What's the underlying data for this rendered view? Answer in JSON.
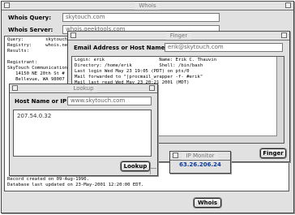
{
  "whois": {
    "title": "Whois",
    "query_label": "Whois Query:",
    "query_value": "skytouch.com",
    "server_label": "Whois Server:",
    "server_value": "whois.geektools.com",
    "output_lines": [
      "Query:        skytouch.com",
      "Registry:     whois.netw",
      "Results:",
      "",
      "Registrant:",
      "SkyTouch Communication",
      "   14150 NE 20th St #",
      "   Bellevue, WA 98007"
    ],
    "footer_lines": [
      "Record created on 09-Aug-1996.",
      "Database last updated on 23-May-2001 12:20:00 EDT."
    ],
    "button": "Whois"
  },
  "finger": {
    "title": "Finger",
    "email_label": "Email Address or Host Name:",
    "email_value": "erik@skytouch.com",
    "output_lines": [
      "Login: erik                    Name: Erik C. Thauvin",
      "Directory: /home/erik          Shell: /bin/bash",
      "Last login Wed May 23 19:05 (PDT) on pts/0",
      "Mail forwarded to \"|procmail_wrapper -f- #erik\"",
      "Mail last read Wed May 23 20:21 2001 (MDT)"
    ],
    "button": "Finger"
  },
  "lookup": {
    "title": "Lookup",
    "host_label": "Host Name or IP:",
    "host_value": "www.skytouch.com",
    "result": "207.54.0.32",
    "button": "Lookup"
  },
  "ip_monitor": {
    "title": "IP Monitor",
    "ip": "63.26.206.24"
  }
}
